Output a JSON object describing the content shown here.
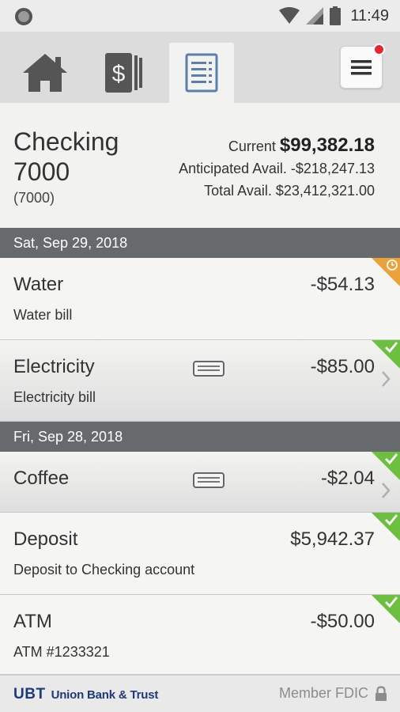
{
  "status_bar": {
    "time": "11:49"
  },
  "nav": {
    "tabs": [
      {
        "icon": "home-icon"
      },
      {
        "icon": "dollar-cards-icon"
      },
      {
        "icon": "document-list-icon",
        "active": true
      }
    ],
    "menu_icon": "hamburger-menu-icon",
    "notification": true
  },
  "account": {
    "name": "Checking 7000",
    "number": "(7000)",
    "current_label": "Current",
    "current_value": "$99,382.18",
    "anticipated_label": "Anticipated Avail.",
    "anticipated_value": "-$218,247.13",
    "total_label": "Total Avail.",
    "total_value": "$23,412,321.00"
  },
  "groups": [
    {
      "date": "Sat, Sep 29, 2018",
      "transactions": [
        {
          "title": "Water",
          "subtitle": "Water bill",
          "amount": "-$54.13",
          "status": "pending"
        },
        {
          "title": "Electricity",
          "subtitle": "Electricity bill",
          "amount": "-$85.00",
          "status": "cleared"
        }
      ]
    },
    {
      "date": "Fri, Sep 28, 2018",
      "transactions": [
        {
          "title": "Coffee",
          "subtitle": "",
          "amount": "-$2.04",
          "status": "cleared"
        },
        {
          "title": "Deposit",
          "subtitle": "Deposit to Checking account",
          "amount": "$5,942.37",
          "status": "cleared"
        },
        {
          "title": "ATM",
          "subtitle": "ATM #1233321",
          "amount": "-$50.00",
          "status": "cleared"
        }
      ]
    }
  ],
  "footer": {
    "brand_logo": "UBT",
    "brand_name": "Union Bank & Trust",
    "member_label": "Member FDIC"
  },
  "colors": {
    "nav_active": "#f2f2f0",
    "date_bar": "#676a6d",
    "status_cleared": "#6dbf3f",
    "status_pending": "#eba23a",
    "brand": "#1e3a78",
    "notification": "#e8262f"
  }
}
